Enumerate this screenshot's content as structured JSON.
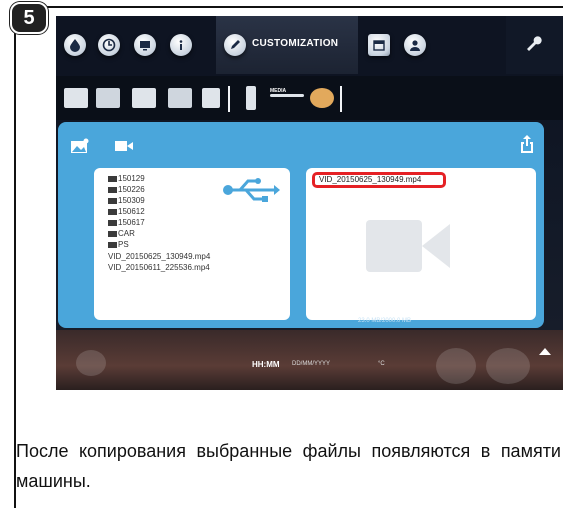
{
  "step": "5",
  "top_tabs": {
    "active_label": "CUSTOMIZATION"
  },
  "media_toolbar": {
    "media_label": "MEDIA"
  },
  "usb_list": {
    "items": [
      {
        "type": "folder",
        "label": "150129"
      },
      {
        "type": "folder",
        "label": "150226"
      },
      {
        "type": "folder",
        "label": "150309"
      },
      {
        "type": "folder",
        "label": "150612"
      },
      {
        "type": "folder",
        "label": "150617"
      },
      {
        "type": "folder",
        "label": "CAR"
      },
      {
        "type": "folder",
        "label": "PS"
      },
      {
        "type": "file",
        "label": "VID_20150625_130949.mp4"
      },
      {
        "type": "file",
        "label": "VID_20150611_225536.mp4"
      }
    ]
  },
  "internal_memory": {
    "copied_file": "VID_20150625_130949.mp4",
    "storage_text": "23.0 MB/2000.0 MB"
  },
  "status_bar": {
    "time": "HH:MM",
    "date": "DD/MM/YYYY",
    "temp": "°C"
  },
  "caption": "После копирования выбранные файлы появляются в памяти машины.",
  "colors": {
    "panel": "#4aa6db",
    "highlight": "#e52125"
  }
}
